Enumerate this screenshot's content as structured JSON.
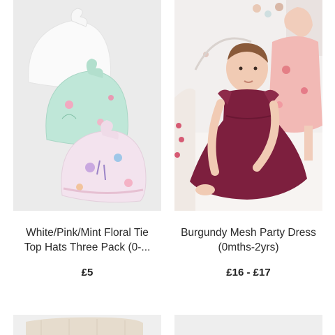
{
  "products": [
    {
      "title_line1": "White/Pink/Mint Floral Tie",
      "title_line2": "Top Hats Three Pack (0-...",
      "price": "£5",
      "image": "baby-hats-photo"
    },
    {
      "title_line1": "Burgundy Mesh Party Dress",
      "title_line2": "(0mths-2yrs)",
      "price": "£16 - £17",
      "image": "baby-dress-photo"
    }
  ],
  "colors": {
    "image_bg_left": "#ebebeb",
    "dress_burgundy": "#7d1f3e",
    "hat_mint": "#bfe7d8",
    "hat_floral": "#f3e3ee"
  }
}
